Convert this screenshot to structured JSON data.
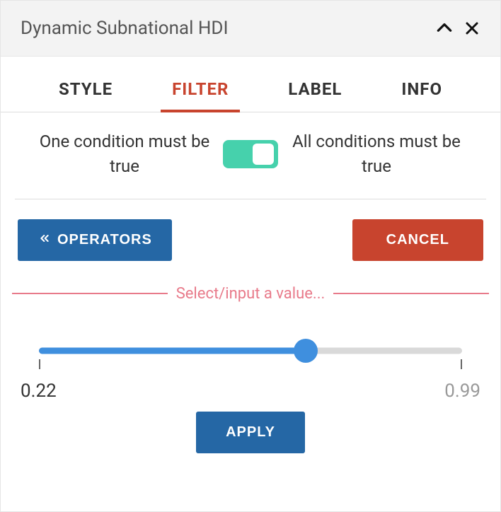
{
  "header": {
    "title": "Dynamic Subnational HDI"
  },
  "tabs": {
    "style": "STYLE",
    "filter": "FILTER",
    "label": "LABEL",
    "info": "INFO"
  },
  "conditions": {
    "one": "One condition must be true",
    "all": "All conditions must be true"
  },
  "buttons": {
    "operators": "OPERATORS",
    "cancel": "CANCEL",
    "apply": "APPLY"
  },
  "divider": {
    "text": "Select/input a value..."
  },
  "slider": {
    "min": "0.22",
    "max": "0.99"
  }
}
